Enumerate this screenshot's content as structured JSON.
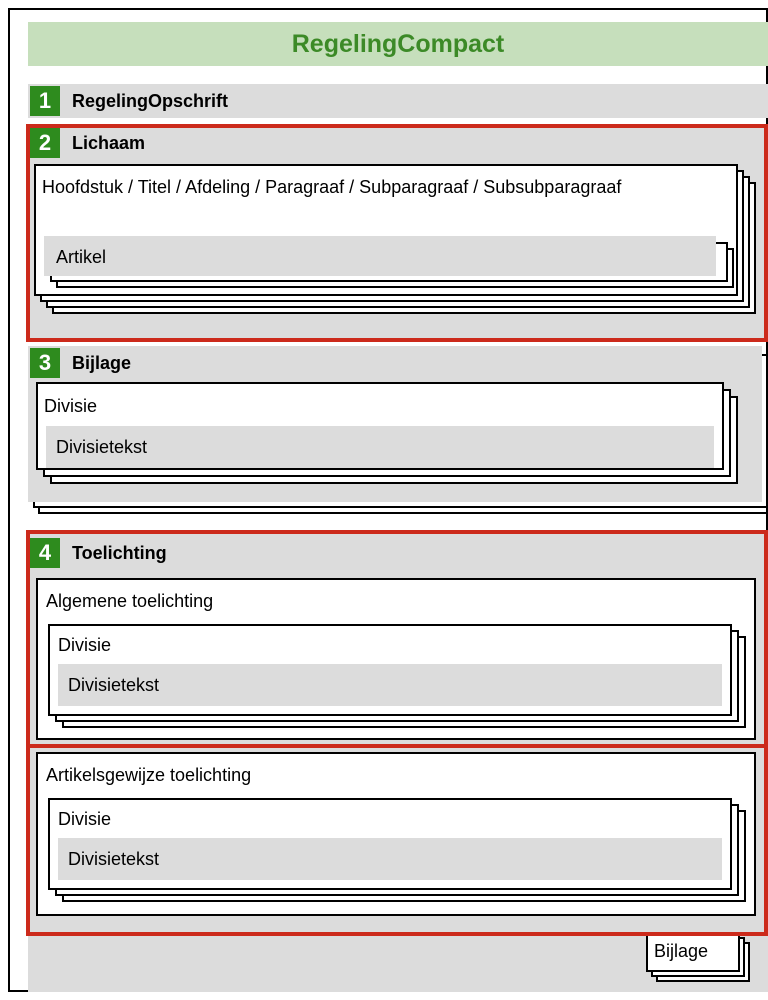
{
  "diagram": {
    "title": "RegelingCompact",
    "sections": [
      {
        "number": "1",
        "label": "RegelingOpschrift"
      },
      {
        "number": "2",
        "label": "Lichaam",
        "container_text": "Hoofdstuk / Titel / Afdeling / Paragraaf / Subparagraaf / Subsubparagraaf",
        "inner": "Artikel"
      },
      {
        "number": "3",
        "label": "Bijlage",
        "container_text": "Divisie",
        "inner": "Divisietekst"
      },
      {
        "number": "4",
        "label": "Toelichting",
        "groups": [
          {
            "title": "Algemene toelichting",
            "container_text": "Divisie",
            "inner": "Divisietekst"
          },
          {
            "title": "Artikelsgewijze toelichting",
            "container_text": "Divisie",
            "inner": "Divisietekst"
          }
        ]
      }
    ],
    "bottom_box": "Bijlage"
  },
  "colors": {
    "title_bar": "#c6dfbc",
    "title_text": "#3c8a27",
    "number_badge": "#2e8b1e",
    "gray": "#dcdcdc",
    "highlight": "#cc2a1b"
  }
}
